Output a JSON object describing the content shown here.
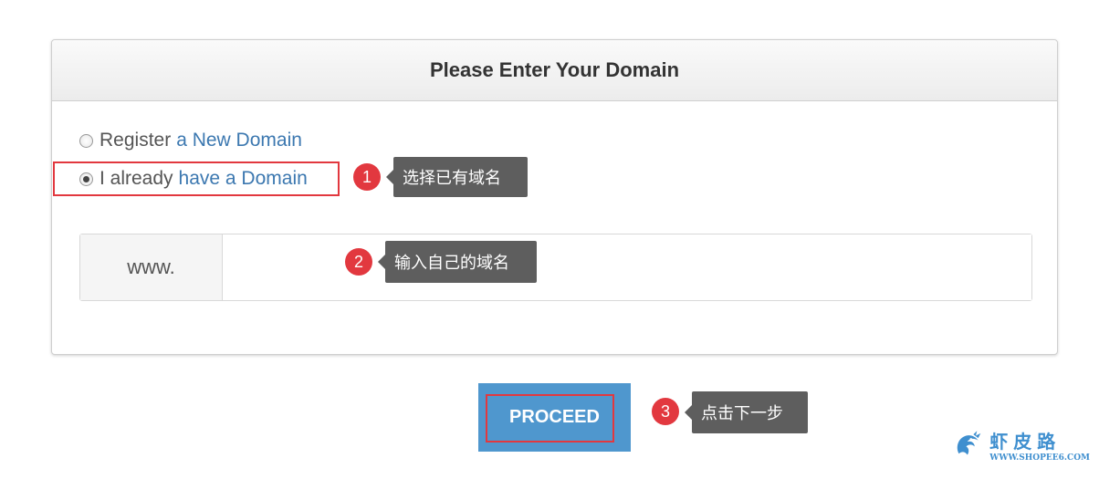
{
  "panel": {
    "title": "Please Enter Your Domain"
  },
  "options": {
    "register_prefix": "Register",
    "register_link": "a New Domain",
    "existing_prefix": "I already",
    "existing_link": "have a Domain",
    "selected": "existing"
  },
  "domain": {
    "prefix": "www.",
    "value": ""
  },
  "annotations": [
    {
      "number": "1",
      "text": "选择已有域名"
    },
    {
      "number": "2",
      "text": "输入自己的域名"
    },
    {
      "number": "3",
      "text": "点击下一步"
    }
  ],
  "proceed_label": "PROCEED",
  "watermark": {
    "name": "虾皮路",
    "url": "WWW.SHOPEE6.COM",
    "logo": "dragon-logo"
  },
  "colors": {
    "accent": "#4f97ce",
    "link": "#3c78b0",
    "annotation_red": "#e2383f",
    "tooltip_bg": "#5e5e5e"
  }
}
